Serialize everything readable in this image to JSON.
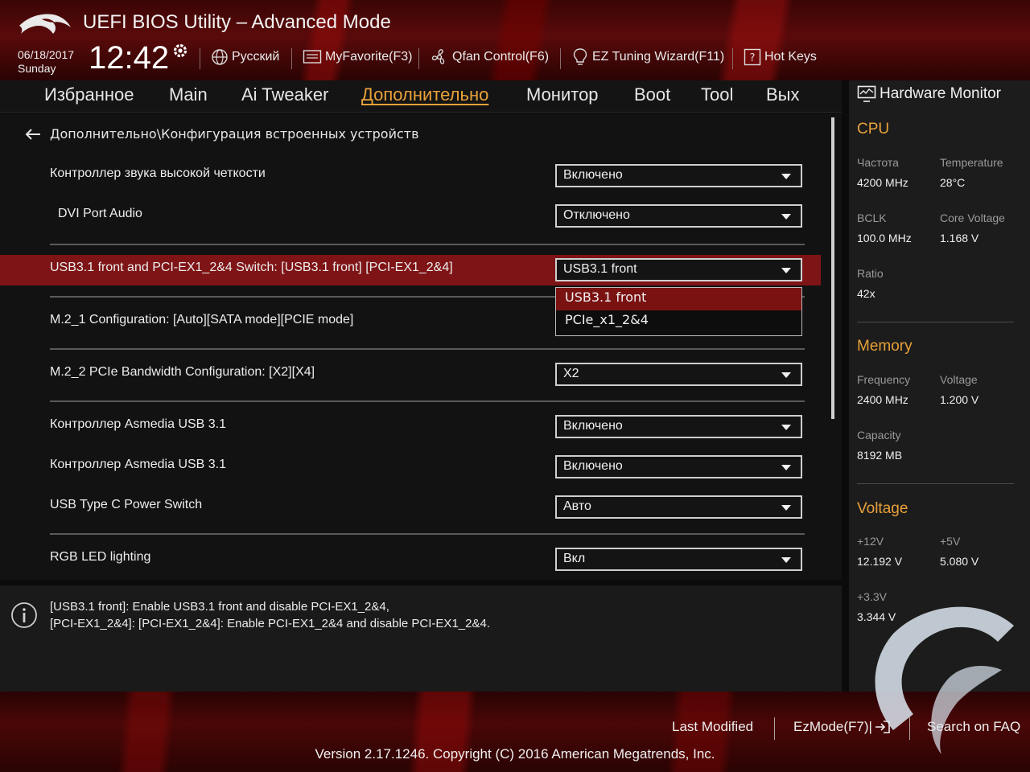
{
  "header": {
    "title": "UEFI BIOS Utility – Advanced Mode",
    "date": "06/18/2017",
    "day": "Sunday",
    "time": "12:42",
    "items": {
      "language": "Русский",
      "myfavorite": "MyFavorite(F3)",
      "qfan": "Qfan Control(F6)",
      "ez_tuning": "EZ Tuning Wizard(F11)",
      "hotkeys": "Hot Keys"
    }
  },
  "tabs": [
    "Избранное",
    "Main",
    "Ai Tweaker",
    "Дополнительно",
    "Монитор",
    "Boot",
    "Tool",
    "Вых"
  ],
  "active_tab": "Дополнительно",
  "breadcrumb": "Дополнительно\\Конфигурация встроенных устройств",
  "settings": [
    {
      "label": "Контроллер звука высокой четкости",
      "value": "Включено"
    },
    {
      "label": "DVI Port Audio",
      "value": "Отключено"
    },
    {
      "label": "USB3.1 front and PCI-EX1_2&4 Switch: [USB3.1 front] [PCI-EX1_2&4]",
      "value": "USB3.1 front"
    },
    {
      "label": "M.2_1 Configuration: [Auto][SATA mode][PCIE mode]",
      "value": ""
    },
    {
      "label": "M.2_2 PCIe Bandwidth Configuration: [X2][X4]",
      "value": "X2"
    },
    {
      "label": "Контроллер Asmedia USB 3.1",
      "value": "Включено"
    },
    {
      "label": "Контроллер Asmedia USB 3.1",
      "value": "Включено"
    },
    {
      "label": "USB Type C Power Switch",
      "value": "Авто"
    },
    {
      "label": "RGB LED lighting",
      "value": "Вкл"
    }
  ],
  "dropdown_options": [
    "USB3.1 front",
    "PCIe_x1_2&4"
  ],
  "help": {
    "line1": "[USB3.1 front]: Enable USB3.1 front and disable PCI-EX1_2&4,",
    "line2": "[PCI-EX1_2&4]: [PCI-EX1_2&4]: Enable PCI-EX1_2&4 and disable PCI-EX1_2&4."
  },
  "hardware_monitor": {
    "title": "Hardware Monitor",
    "cpu": {
      "heading": "CPU",
      "freq_label": "Частота",
      "freq": "4200 MHz",
      "temp_label": "Temperature",
      "temp": "28°C",
      "bclk_label": "BCLK",
      "bclk": "100.0 MHz",
      "cv_label": "Core Voltage",
      "cv": "1.168 V",
      "ratio_label": "Ratio",
      "ratio": "42x"
    },
    "memory": {
      "heading": "Memory",
      "freq_label": "Frequency",
      "freq": "2400 MHz",
      "volt_label": "Voltage",
      "volt": "1.200 V",
      "cap_label": "Capacity",
      "cap": "8192 MB"
    },
    "voltage": {
      "heading": "Voltage",
      "v12_label": "+12V",
      "v12": "12.192 V",
      "v5_label": "+5V",
      "v5": "5.080 V",
      "v33_label": "+3.3V",
      "v33": "3.344 V"
    }
  },
  "footer": {
    "last_modified": "Last Modified",
    "ezmode": "EzMode(F7)|",
    "search": "Search on FAQ",
    "version": "Version 2.17.1246. Copyright (C) 2016 American Megatrends, Inc."
  },
  "colors": {
    "accent": "#e8a13a",
    "highlight": "#7e1416",
    "brand_red": "#5a0a0a"
  },
  "icons": [
    "rog-logo",
    "gear-icon",
    "globe-icon",
    "favorite-icon",
    "fan-icon",
    "bulb-icon",
    "question-icon",
    "back-arrow-icon",
    "monitor-icon",
    "info-icon",
    "exit-icon"
  ]
}
